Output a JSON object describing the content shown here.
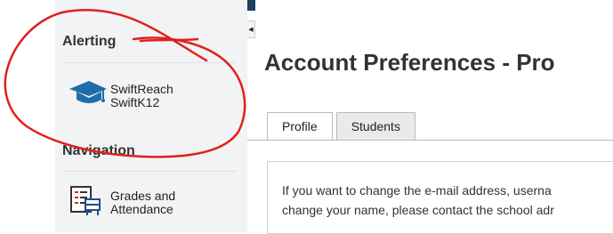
{
  "sidebar": {
    "alerting_heading": "Alerting",
    "alerting_item": {
      "line1": "SwiftReach",
      "line2": "SwiftK12",
      "icon": "graduation-cap-icon"
    },
    "navigation_heading": "Navigation",
    "navigation_item": {
      "line1": "Grades and",
      "line2": "Attendance",
      "icon": "gradebook-icon"
    }
  },
  "main": {
    "title": "Account Preferences - Pro",
    "tabs": [
      {
        "label": "Profile",
        "active": true
      },
      {
        "label": "Students",
        "active": false
      }
    ],
    "panel": {
      "line1": "If you want to change the e-mail address, userna",
      "line2": "change your name, please contact the school adr"
    }
  },
  "colors": {
    "annotation": "#e0201c",
    "sidebar_bg": "#f1f3f5",
    "cap_icon": "#1e6fa8"
  }
}
